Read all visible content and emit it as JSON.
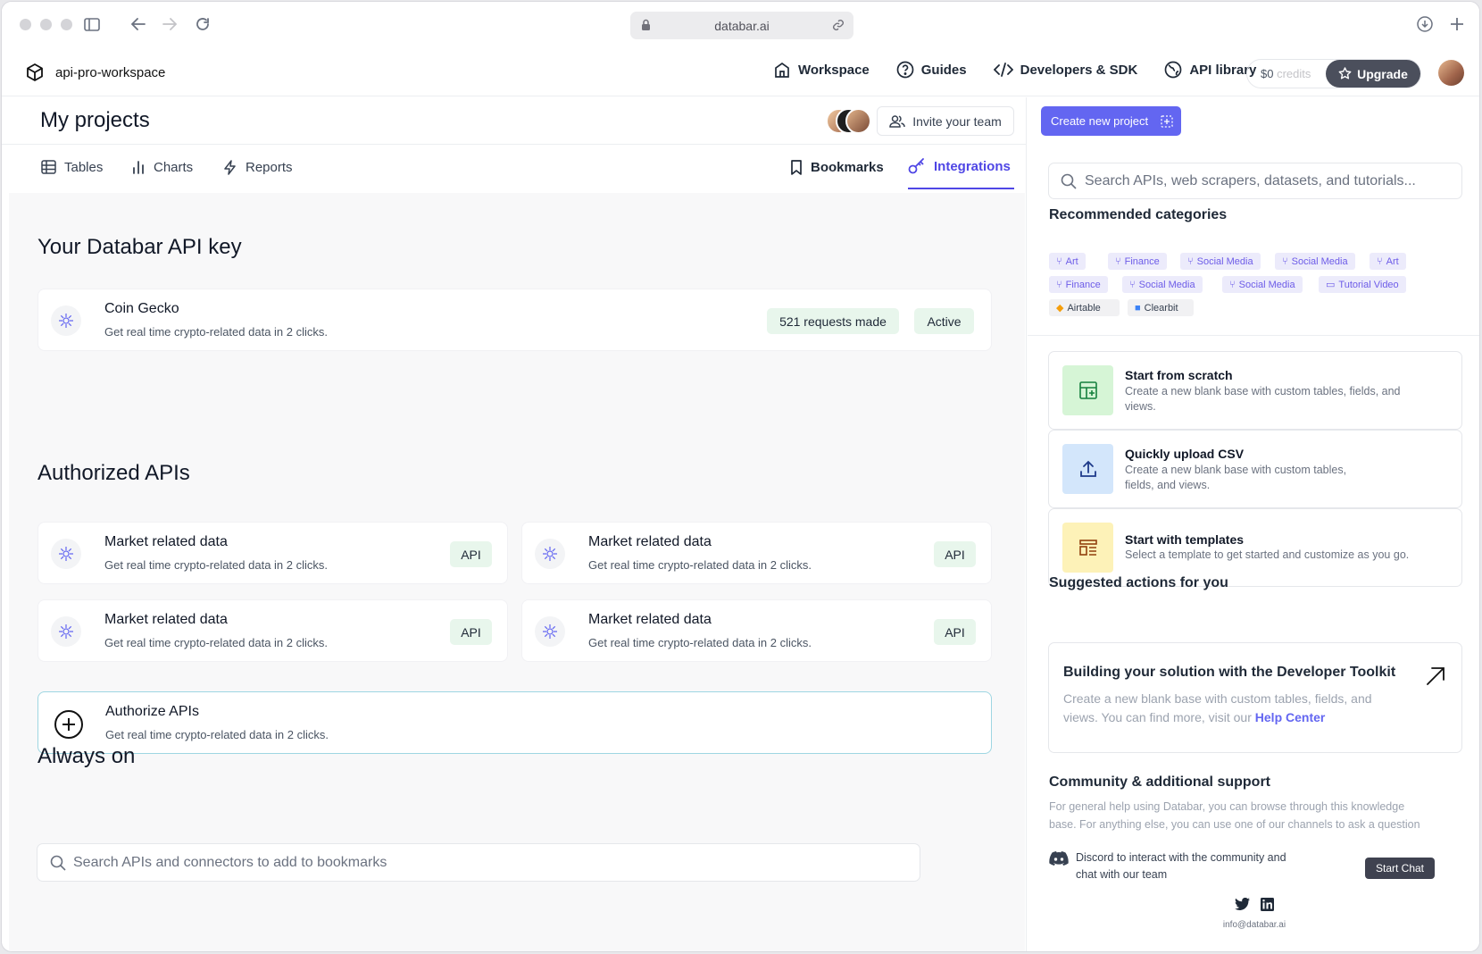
{
  "browser": {
    "url": "databar.ai"
  },
  "nav": {
    "workspace_name": "api-pro-workspace",
    "items": [
      {
        "label": "Workspace",
        "icon": "home-icon"
      },
      {
        "label": "Guides",
        "icon": "help-circle-icon"
      },
      {
        "label": "Developers & SDK",
        "icon": "code-icon"
      },
      {
        "label": "API library",
        "icon": "globe-icon"
      }
    ],
    "credits_amount": "$0",
    "credits_label": "credits",
    "upgrade_label": "Upgrade"
  },
  "main": {
    "title": "My projects",
    "invite_label": "Invite your team",
    "tabs": [
      {
        "label": "Tables",
        "icon": "table-icon"
      },
      {
        "label": "Charts",
        "icon": "bar-chart-icon"
      },
      {
        "label": "Reports",
        "icon": "lightning-icon"
      },
      {
        "label": "Bookmarks",
        "icon": "bookmark-icon"
      },
      {
        "label": "Integrations",
        "icon": "key-icon",
        "active": true
      }
    ],
    "api_key_section": {
      "heading": "Your Databar API key",
      "card": {
        "title": "Coin Gecko",
        "description": "Get real time crypto-related data in 2 clicks.",
        "requests": "521 requests made",
        "status": "Active"
      }
    },
    "authorized_section": {
      "heading": "Authorized APIs",
      "cards": [
        {
          "title": "Market related data",
          "description": "Get real time crypto-related data in 2 clicks.",
          "badge": "API"
        },
        {
          "title": "Market related data",
          "description": "Get real time crypto-related data in 2 clicks.",
          "badge": "API"
        },
        {
          "title": "Market related data",
          "description": "Get real time crypto-related data in 2 clicks.",
          "badge": "API"
        },
        {
          "title": "Market related data",
          "description": "Get real time crypto-related data in 2 clicks.",
          "badge": "API"
        }
      ],
      "authorize": {
        "title": "Authorize APIs",
        "description": "Get real time crypto-related data in 2 clicks."
      }
    },
    "always_on": {
      "heading": "Always on",
      "search_placeholder": "Search APIs and connectors to add to bookmarks"
    }
  },
  "side": {
    "create_label": "Create new project",
    "search_placeholder": "Search APIs, web scrapers, datasets, and tutorials...",
    "recommended_heading": "Recommended categories",
    "chips": [
      "Art",
      "Finance",
      "Social Media",
      "Social Media",
      "Art",
      "Finance",
      "Social Media",
      "Social Media",
      "Tutorial Video",
      "Airtable",
      "Clearbit"
    ],
    "options": [
      {
        "title": "Start from scratch",
        "description": "Create a new blank base with custom tables, fields, and views.",
        "color": "#d6f5d6"
      },
      {
        "title": "Quickly upload CSV",
        "description": "Create a new blank base with custom tables, fields, and views.",
        "color": "#d3e6fb"
      },
      {
        "title": "Start with templates",
        "description": "Select a template to get started and customize as you go.",
        "color": "#fdf2b8"
      }
    ],
    "suggested_heading": "Suggested actions for you",
    "dev_card": {
      "title": "Building your solution with the Developer Toolkit",
      "description": "Create a new blank base with custom tables, fields, and views. You can find more, visit our",
      "link": "Help Center"
    },
    "community_heading": "Community & additional support",
    "community_desc": "For general help using Databar, you can browse through this knowledge base. For anything else, you can use one of our channels to ask a question",
    "discord_text": "Discord to interact with the community and chat with our team",
    "start_chat": "Start Chat",
    "email": "info@databar.ai"
  },
  "colors": {
    "accent": "#4f46e5",
    "button": "#6366f1",
    "pill_bg": "#e8f6ec",
    "chip_bg": "#ecebfb"
  }
}
